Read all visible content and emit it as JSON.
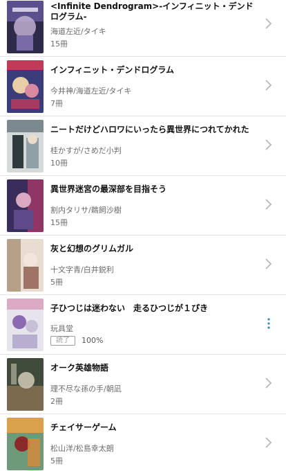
{
  "books": [
    {
      "title": "<Infinite Dendrogram>-インフィニット・デンドログラム-",
      "author": "海道左近/タイキ",
      "count": "15冊",
      "colors": [
        "#5b4f8c",
        "#c9b6d8",
        "#2d2a4a"
      ]
    },
    {
      "title": "インフィニット・デンドログラム",
      "author": "今井神/海道左近/タイキ",
      "count": "7冊",
      "colors": [
        "#c23a5a",
        "#e9cfa8",
        "#3b3c7a"
      ]
    },
    {
      "title": "ニートだけどハロワにいったら異世界につれてかれた",
      "author": "桂かすが/さめだ小判",
      "count": "10冊",
      "colors": [
        "#7c8a8f",
        "#d4d9da",
        "#2f3a3f"
      ]
    },
    {
      "title": "異世界迷宮の最深部を目指そう",
      "author": "割内タリサ/鵜飼沙樹",
      "count": "15冊",
      "colors": [
        "#3a2d5c",
        "#b33a6b",
        "#d9a9c4"
      ]
    },
    {
      "title": "灰と幻想のグリムガル",
      "author": "十文字青/白井鋭利",
      "count": "5冊",
      "colors": [
        "#b7a08a",
        "#e8ddd0",
        "#8a5a4a"
      ]
    },
    {
      "title": "子ひつじは迷わない　走るひつじが１ぴき",
      "author": "玩具堂",
      "status": "読了",
      "progress": "100%",
      "colors": [
        "#e8e4ee",
        "#8a6ab0",
        "#c8407a"
      ]
    },
    {
      "title": "オーク英雄物語",
      "author": "理不尽な孫の手/朝凪",
      "count": "2冊",
      "colors": [
        "#3f4a3a",
        "#7c6a4e",
        "#c9c3b0"
      ]
    },
    {
      "title": "チェイサーゲーム",
      "author": "松山洋/松島幸太朗",
      "count": "5冊",
      "colors": [
        "#6f9a7a",
        "#d9a24a",
        "#8a2a2a"
      ]
    }
  ]
}
